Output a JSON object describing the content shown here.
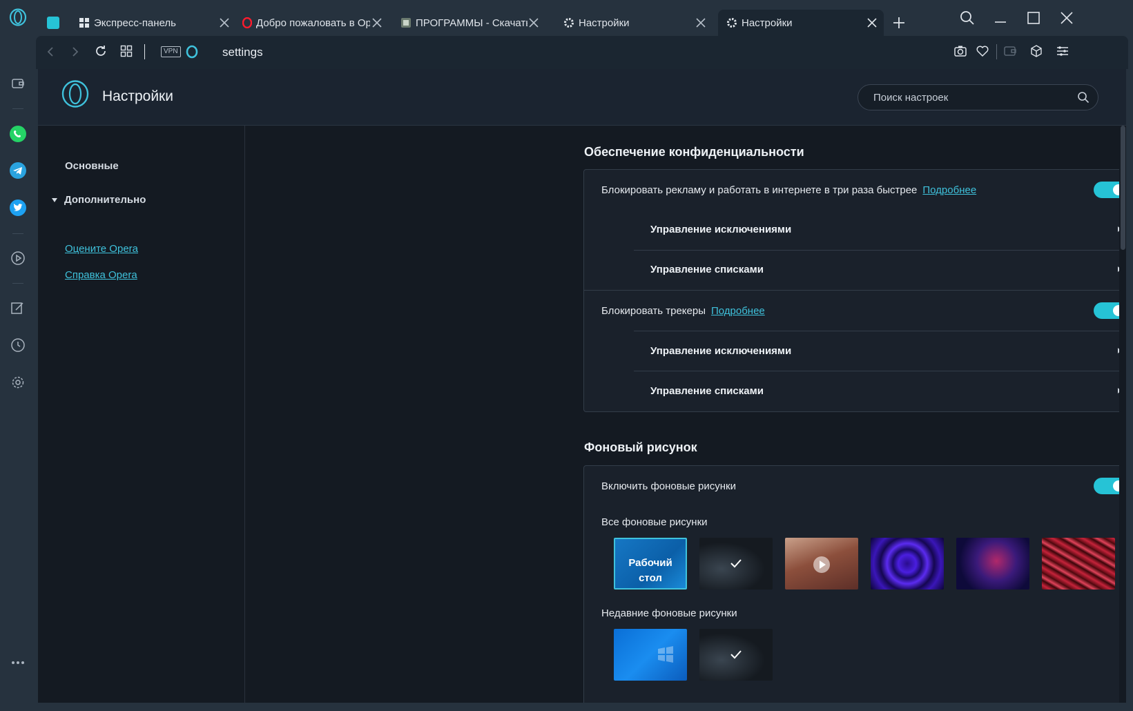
{
  "browser": {
    "tabs": [
      {
        "label": "Экспресс-панель",
        "icon": "speed-dial-icon"
      },
      {
        "label": "Добро пожаловать в Opera",
        "icon": "opera-logo-icon"
      },
      {
        "label": "ПРОГРАММЫ - Скачать (",
        "icon": "site-favicon"
      },
      {
        "label": "Настройки",
        "icon": "gear-icon"
      },
      {
        "label": "Настройки",
        "icon": "gear-icon"
      }
    ],
    "vpn_label": "VPN",
    "url": "settings"
  },
  "settings": {
    "page_title": "Настройки",
    "search_placeholder": "Поиск настроек",
    "nav": {
      "basic": "Основные",
      "advanced": "Дополнительно",
      "rate_link": "Оцените Opera",
      "help_link": "Справка Opera"
    },
    "privacy": {
      "title": "Обеспечение конфиденциальности",
      "ad_block_label": "Блокировать рекламу и работать в интернете в три раза быстрее",
      "ad_block_more": "Подробнее",
      "ad_block_enabled": true,
      "manage_exceptions_1": "Управление исключениями",
      "manage_lists_1": "Управление списками",
      "trackers_label": "Блокировать трекеры",
      "trackers_more": "Подробнее",
      "trackers_enabled": true,
      "manage_exceptions_2": "Управление исключениями",
      "manage_lists_2": "Управление списками"
    },
    "wallpaper": {
      "title": "Фоновый рисунок",
      "enable_label": "Включить фоновые рисунки",
      "enable_enabled": true,
      "all_label": "Все фоновые рисунки",
      "desktop_caption_1": "Рабочий",
      "desktop_caption_2": "стол",
      "recent_label": "Недавние фоновые рисунки"
    }
  },
  "colors": {
    "accent": "#26c3d6",
    "link": "#3fc2dc",
    "background": "#141a22"
  }
}
